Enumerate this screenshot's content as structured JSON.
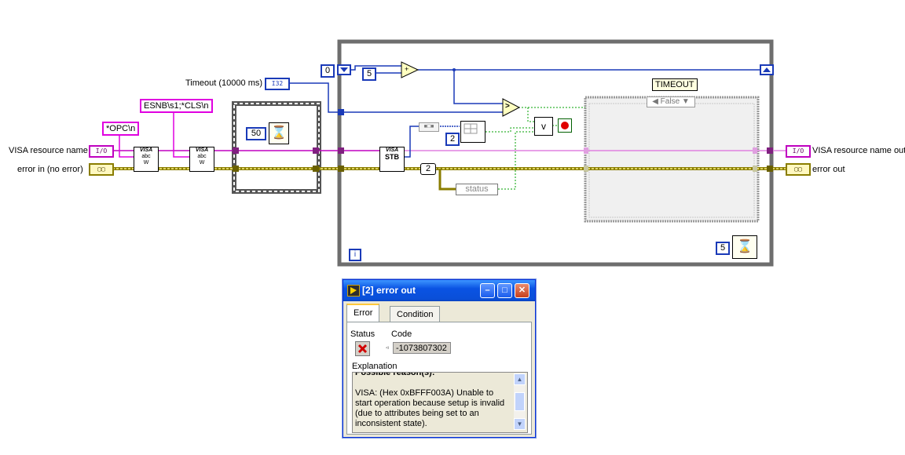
{
  "inputs": {
    "visa_resource_name": "VISA resource name",
    "error_in": "error in (no error)",
    "timeout_label": "Timeout (10000 ms)"
  },
  "outputs": {
    "visa_resource_name_out": "VISA resource name out",
    "error_out": "error out"
  },
  "constants": {
    "opc_string": "*OPC\\n",
    "esnb_string": "ESNB\\s1;*CLS\\n",
    "wait_ms_1": "50",
    "loop_start": "0",
    "increment": "5",
    "split_index": "2",
    "wait_ms_2": "5",
    "array_index": "2",
    "i32_type": "I32"
  },
  "nodes": {
    "visa_stb": "STB",
    "visa_prefix": "VISA",
    "status_label": "status",
    "timeout_case_label": "TIMEOUT",
    "case_selector": "False",
    "loop_iteration": "i",
    "or_symbol": "v",
    "add_symbol": "+",
    "compare_symbol": ">"
  },
  "dialog": {
    "title": "[2] error out",
    "tabs": [
      {
        "label": "Error"
      },
      {
        "label": "Condition"
      }
    ],
    "status_label": "Status",
    "code_label": "Code",
    "code_value": "-1073807302",
    "explanation_label": "Explanation",
    "explanation_partial": "Possible reason(s):",
    "explanation_text": "VISA:  (Hex 0xBFFF003A) Unable to start operation because setup is invalid (due to attributes being set to an inconsistent state)."
  },
  "colors": {
    "visa_wire": "#c000c0",
    "error_wire": "#8a7d00",
    "numeric_wire": "#1a3ab8",
    "boolean_wire": "#00a000",
    "titlebar": "#0a53e3"
  },
  "icons": [
    "visa-write-icon",
    "wait-ms-icon",
    "visa-read-stb-icon",
    "stop-button-icon",
    "close-icon",
    "minimize-icon",
    "maximize-icon",
    "error-x-icon",
    "scroll-up-icon",
    "scroll-down-icon"
  ]
}
